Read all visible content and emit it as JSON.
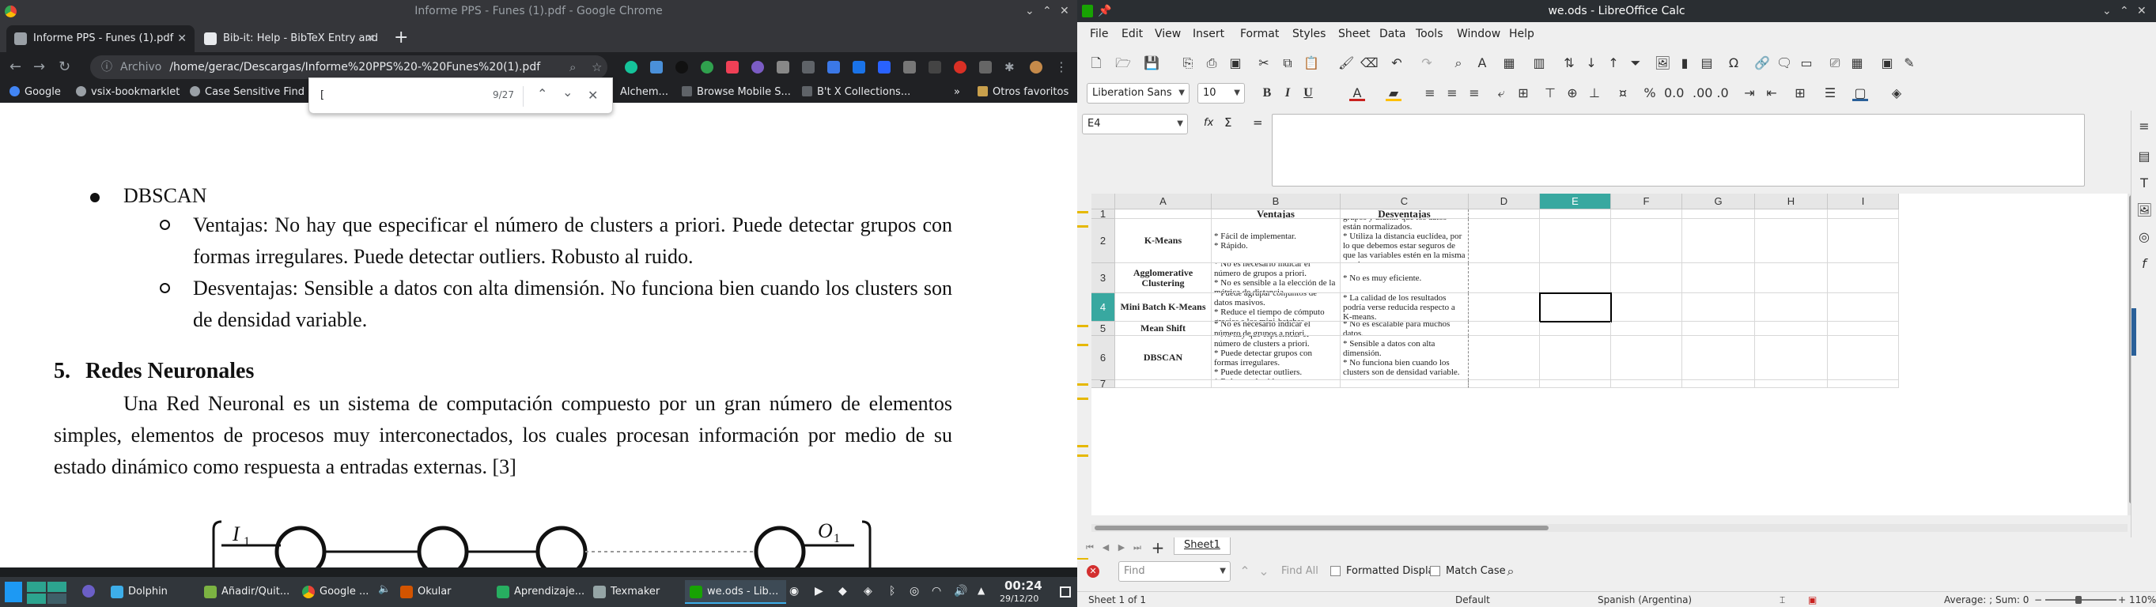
{
  "chrome": {
    "window_title": "Informe PPS - Funes (1).pdf - Google Chrome",
    "tabs": [
      {
        "label": "Informe PPS - Funes (1).pdf",
        "active": true
      },
      {
        "label": "Bib-it: Help - BibTeX Entry and",
        "active": false
      }
    ],
    "new_tab": "+",
    "omnibox": {
      "scheme_label": "Archivo",
      "url": "/home/gerac/Descargas/Informe%20PPS%20-%20Funes%20(1).pdf"
    },
    "bookmarks": [
      "Google",
      "vsix-bookmarklet",
      "Case Sensitive Find",
      "Alchem...",
      "Browse Mobile S...",
      "B't X Collections...",
      "»",
      "Otros favoritos"
    ],
    "find": {
      "value": "[",
      "count": "9/27"
    },
    "pdf": {
      "bullet_title": "DBSCAN",
      "sub_bullets": [
        "Ventajas: No hay que especificar el número de clusters a priori. Puede detectar grupos con formas irregulares. Puede detectar outliers. Robusto al ruido.",
        "Desventajas: Sensible a datos con alta dimensión. No funciona bien cuando los clusters son de densidad variable."
      ],
      "section_number": "5.",
      "section_title": "Redes Neuronales",
      "paragraph": "Una Red Neuronal es un sistema de computación compuesto por un gran número de elementos simples, elementos de procesos muy interconectados, los cuales procesan información por medio de su estado dinámico como respuesta a entradas externas. [3]",
      "figure_labels": {
        "input": "I",
        "input_sub": "1",
        "output": "O",
        "output_sub": "1"
      }
    }
  },
  "taskbar": {
    "items": [
      "Dolphin",
      "Añadir/Quit...",
      "Google ...",
      "Okular",
      "Aprendizaje...",
      "Texmaker",
      "we.ods - Lib..."
    ],
    "time": "00:24",
    "date": "29/12/20"
  },
  "calc": {
    "window_title": "we.ods - LibreOffice Calc",
    "menu": [
      "File",
      "Edit",
      "View",
      "Insert",
      "Format",
      "Styles",
      "Sheet",
      "Data",
      "Tools",
      "Window",
      "Help"
    ],
    "font_name": "Liberation Sans",
    "font_size": "10",
    "name_box": "E4",
    "formula_symbols": [
      "fx",
      "Σ",
      "="
    ],
    "columns": [
      "A",
      "B",
      "C",
      "D",
      "E",
      "F",
      "G",
      "H",
      "I"
    ],
    "rows": [
      {
        "num": "1",
        "cells": [
          "",
          "Ventajas",
          "Desventajas"
        ]
      },
      {
        "num": "2",
        "cells": [
          "K-Means",
          "* Fácil de implementar.\n* Rápido.",
          "* Hay que conocer el número de grupos y asumir que los datos están normalizados.\n* Utiliza la distancia euclídea, por lo que debemos estar seguros de que las variables estén en la misma escala.\n* Sensible al ruido."
        ]
      },
      {
        "num": "3",
        "cells": [
          "Agglomerative Clustering",
          "* No es necesario indicar el número de grupos a priori.\n* No es sensible a la elección de la métrica de distancia.",
          "* No es muy eficiente."
        ]
      },
      {
        "num": "4",
        "cells": [
          "Mini Batch K-Means",
          "* Puede agrupar conjuntos de datos masivos.\n* Reduce el tiempo de cómputo gracias a los mini-batches.",
          "* La calidad de los resultados podría verse reducida respecto a K-means."
        ]
      },
      {
        "num": "5",
        "cells": [
          "Mean Shift",
          "* No es necesario indicar el número de grupos a priori.",
          "* No es escalable para muchos datos."
        ]
      },
      {
        "num": "6",
        "cells": [
          "DBSCAN",
          "* No hay que especificar el número de clusters a priori.\n* Puede detectar grupos con formas irregulares.\n* Puede detectar outliers.\n* Robusto al ruido.",
          "* Sensible a datos con alta dimensión.\n* No funciona bien cuando los clusters son de densidad variable."
        ]
      },
      {
        "num": "7",
        "cells": [
          "",
          "",
          ""
        ]
      }
    ],
    "sheet_tab": "Sheet1",
    "find_toolbar": {
      "placeholder": "Find",
      "find_all": "Find All",
      "formatted_display": "Formatted Display",
      "match_case": "Match Case"
    },
    "status": {
      "sheet": "Sheet 1 of 1",
      "style": "Default",
      "language": "Spanish (Argentina)",
      "summary": "Average: ; Sum: 0",
      "zoom": "110%"
    }
  },
  "colors": {
    "accent": "#38a8a0",
    "chrome_dark": "#202124",
    "taskbar": "#31363b"
  }
}
